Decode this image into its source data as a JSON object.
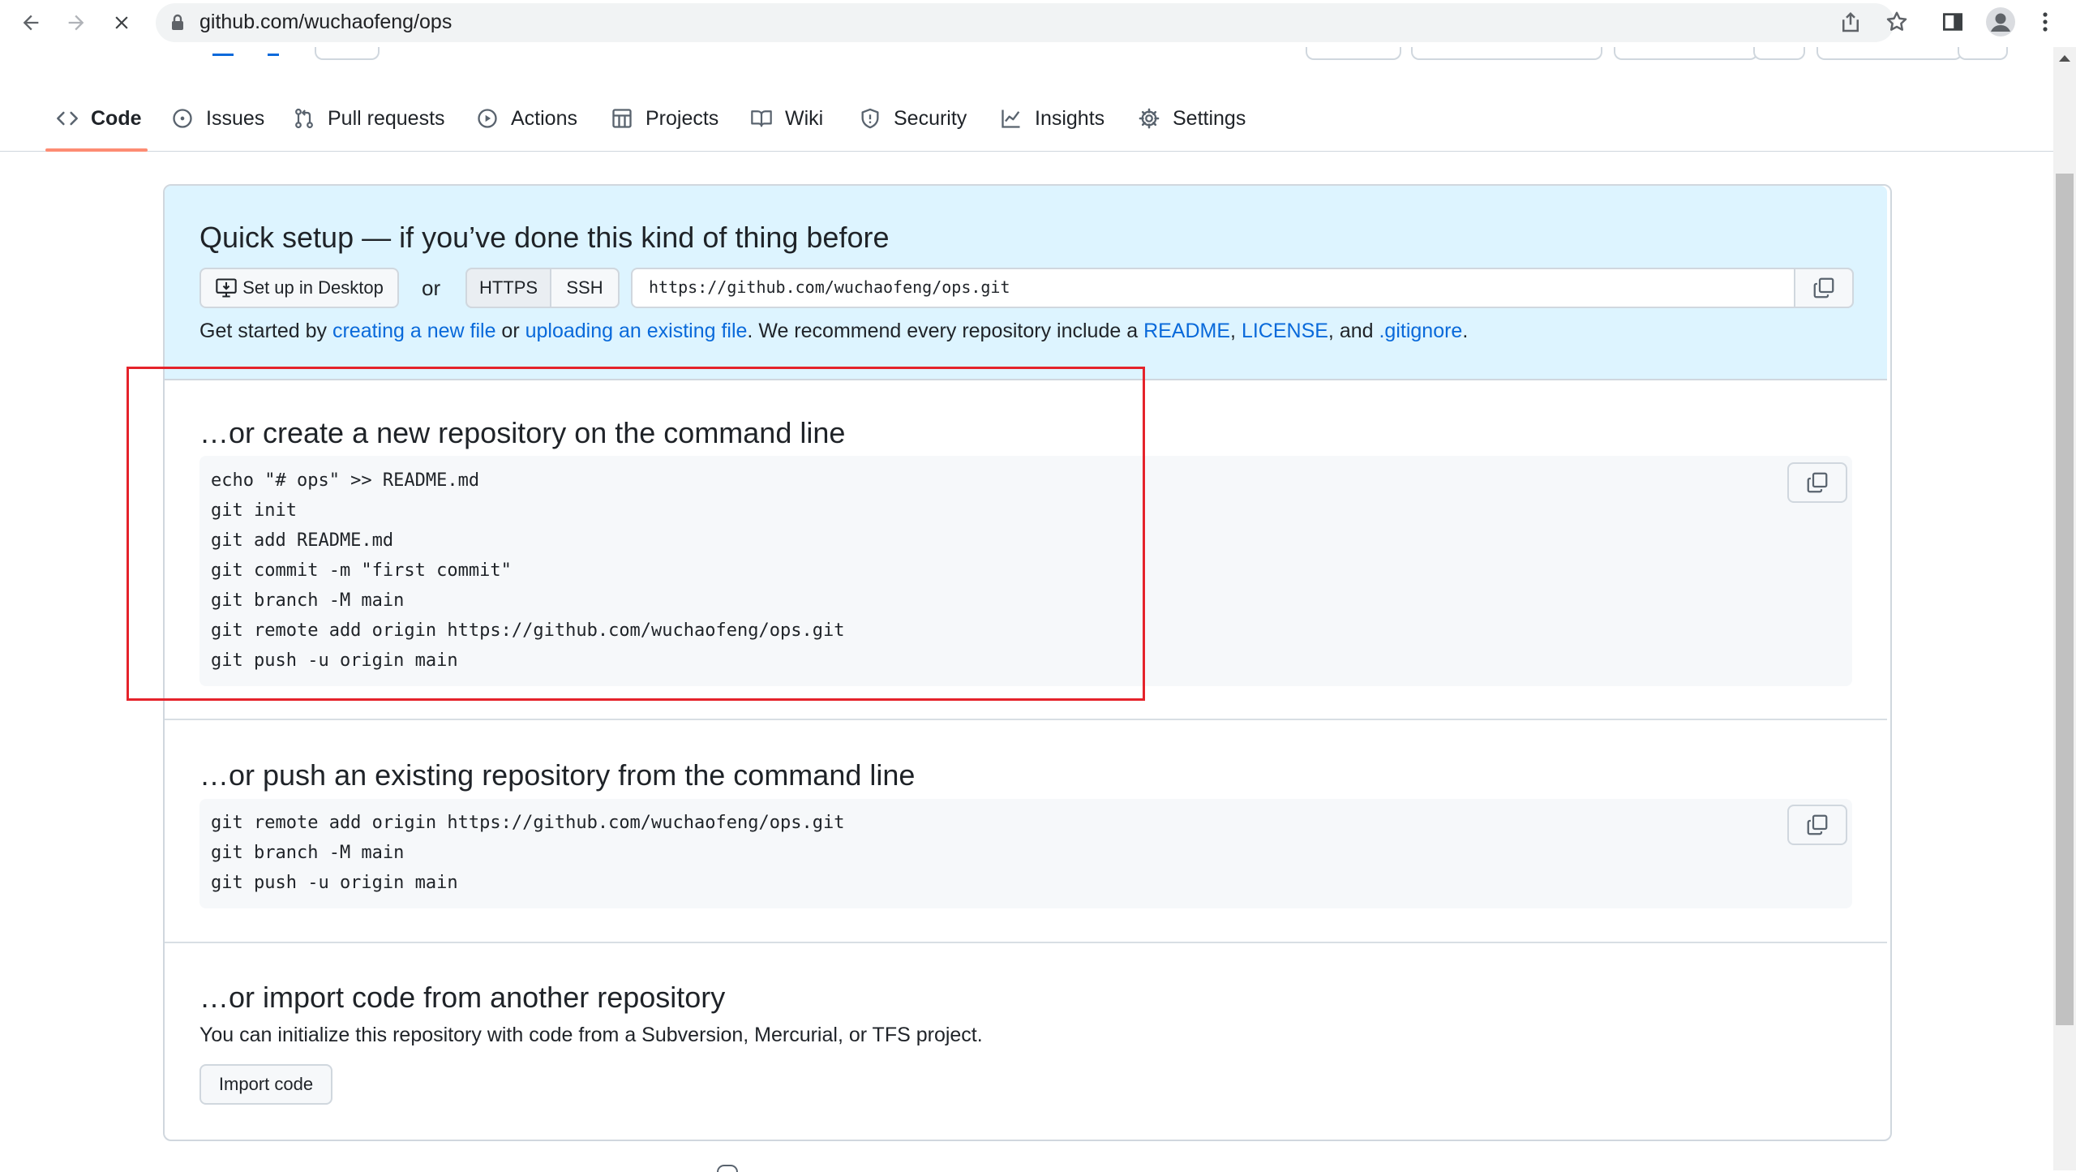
{
  "browser": {
    "url": "github.com/wuchaofeng/ops"
  },
  "tabs": [
    {
      "label": "Code",
      "icon": "code-icon",
      "selected": true
    },
    {
      "label": "Issues",
      "icon": "issue-icon"
    },
    {
      "label": "Pull requests",
      "icon": "pull-request-icon"
    },
    {
      "label": "Actions",
      "icon": "play-icon"
    },
    {
      "label": "Projects",
      "icon": "table-icon"
    },
    {
      "label": "Wiki",
      "icon": "book-icon"
    },
    {
      "label": "Security",
      "icon": "shield-icon"
    },
    {
      "label": "Insights",
      "icon": "graph-icon"
    },
    {
      "label": "Settings",
      "icon": "gear-icon"
    }
  ],
  "quick_setup": {
    "title": "Quick setup — if you’ve done this kind of thing before",
    "desktop_button": "Set up in Desktop",
    "or": "or",
    "https_label": "HTTPS",
    "ssh_label": "SSH",
    "clone_url": "https://github.com/wuchaofeng/ops.git",
    "intro_text": {
      "t1": "Get started by ",
      "link1": "creating a new file",
      "t2": " or ",
      "link2": "uploading an existing file",
      "t3": ". We recommend every repository include a ",
      "link3": "README",
      "t4": ", ",
      "link4": "LICENSE",
      "t5": ", and ",
      "link5": ".gitignore",
      "t6": "."
    }
  },
  "new_repo": {
    "title": "…or create a new repository on the command line",
    "lines": [
      "echo \"# ops\" >> README.md",
      "git init",
      "git add README.md",
      "git commit -m \"first commit\"",
      "git branch -M main",
      "git remote add origin https://github.com/wuchaofeng/ops.git",
      "git push -u origin main"
    ]
  },
  "push_existing": {
    "title": "…or push an existing repository from the command line",
    "lines": [
      "git remote add origin https://github.com/wuchaofeng/ops.git",
      "git branch -M main",
      "git push -u origin main"
    ]
  },
  "import_code": {
    "title": "…or import code from another repository",
    "description": "You can initialize this repository with code from a Subversion, Mercurial, or TFS project.",
    "button": "Import code"
  },
  "colors": {
    "link": "#0969da",
    "tab_underline": "#fd8c73",
    "highlight_box": "#e5232b",
    "quick_setup_bg": "#ddf4ff"
  }
}
